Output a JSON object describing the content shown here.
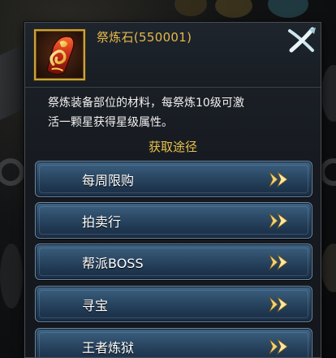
{
  "item": {
    "name": "祭炼石(550001)",
    "icon": "flame-stone-icon",
    "frame_color": "#c9a33c",
    "name_color": "#e6b84a"
  },
  "description": {
    "line1": "祭炼装备部位的材料，每祭炼10级可激",
    "line2": "活一颗星获得星级属性。"
  },
  "acquire": {
    "title": "获取途径",
    "title_color": "#e8c24a",
    "routes": [
      {
        "label": "每周限购"
      },
      {
        "label": "拍卖行"
      },
      {
        "label": "帮派BOSS"
      },
      {
        "label": "寻宝"
      },
      {
        "label": "王者炼狱"
      }
    ]
  },
  "icons": {
    "close": "close-icon",
    "arrow": "double-chevron-right-icon"
  }
}
